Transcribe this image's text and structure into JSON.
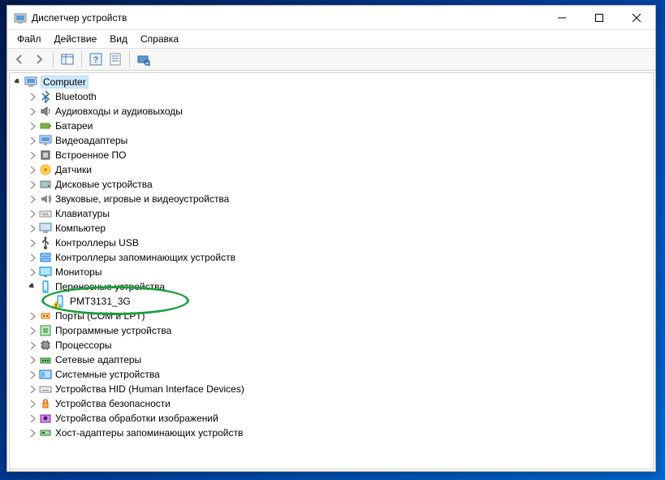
{
  "window": {
    "title": "Диспетчер устройств"
  },
  "menus": {
    "file": "Файл",
    "action": "Действие",
    "view": "Вид",
    "help": "Справка"
  },
  "tree": {
    "root": "Computer",
    "items": [
      "Bluetooth",
      "Аудиовходы и аудиовыходы",
      "Батареи",
      "Видеоадаптеры",
      "Встроенное ПО",
      "Датчики",
      "Дисковые устройства",
      "Звуковые, игровые и видеоустройства",
      "Клавиатуры",
      "Компьютер",
      "Контроллеры USB",
      "Контроллеры запоминающих устройств",
      "Мониторы",
      "Переносные устройства",
      "Порты (COM и LPT)",
      "Программные устройства",
      "Процессоры",
      "Сетевые адаптеры",
      "Системные устройства",
      "Устройства HID (Human Interface Devices)",
      "Устройства безопасности",
      "Устройства обработки изображений",
      "Хост-адаптеры запоминающих устройств"
    ],
    "portable_child": "PMT3131_3G"
  }
}
